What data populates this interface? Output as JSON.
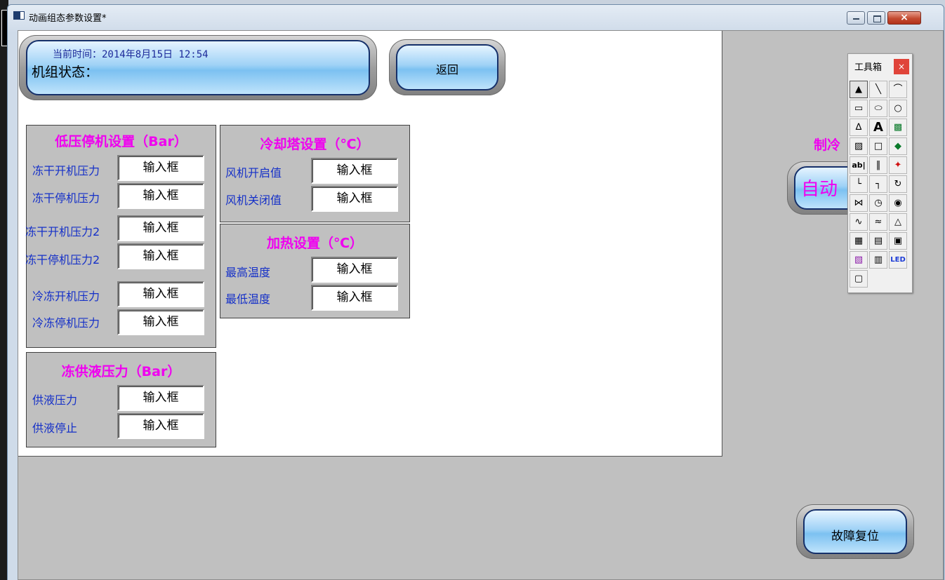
{
  "window": {
    "title": "动画组态参数设置*",
    "close_glyph": "×"
  },
  "header": {
    "time_label": "当前时间：",
    "time_value": "2014年8月15日 12:54",
    "status_label": "机组状态："
  },
  "back_button": "返回",
  "groups": {
    "low_pressure": {
      "title": "低压停机设置（Bar）",
      "rows": [
        {
          "label": "冻干开机压力",
          "value": "输入框"
        },
        {
          "label": "冻干停机压力",
          "value": "输入框"
        },
        {
          "label": "冻干开机压力2",
          "value": "输入框"
        },
        {
          "label": "冻干停机压力2",
          "value": "输入框"
        },
        {
          "label": "冷冻开机压力",
          "value": "输入框"
        },
        {
          "label": "冷冻停机压力",
          "value": "输入框"
        }
      ]
    },
    "supply": {
      "title": "冻供液压力（Bar）",
      "rows": [
        {
          "label": "供液压力",
          "value": "输入框"
        },
        {
          "label": "供液停止",
          "value": "输入框"
        }
      ]
    },
    "cooling_tower": {
      "title": "冷却塔设置（℃）",
      "rows": [
        {
          "label": "风机开启值",
          "value": "输入框"
        },
        {
          "label": "风机关闭值",
          "value": "输入框"
        }
      ]
    },
    "heating": {
      "title": "加热设置（℃）",
      "rows": [
        {
          "label": "最高温度",
          "value": "输入框"
        },
        {
          "label": "最低温度",
          "value": "输入框"
        }
      ]
    }
  },
  "right_panel": {
    "mode_title_partial": "制冷",
    "auto_button_partial": "自动",
    "fault_reset_button": "故障复位"
  },
  "toolbox": {
    "title": "工具箱",
    "close_label": "×",
    "tools": [
      "pointer",
      "line",
      "arc",
      "rectangle",
      "rounded-rect",
      "ellipse",
      "polygon",
      "text",
      "bitmap",
      "picture-button",
      "button-disabled",
      "web",
      "text-input",
      "slider",
      "alarm-switch",
      "angle-line",
      "step-line",
      "spin",
      "valve",
      "gauge",
      "indicator",
      "trend",
      "xy-trend",
      "alarm-bell",
      "grid",
      "table",
      "layers",
      "chart",
      "report",
      "led",
      "alarm-window"
    ],
    "text_tools": {
      "text": "A",
      "input": "ab|",
      "led": "LED"
    }
  },
  "colors": {
    "group_title": "#f000f0",
    "label_blue": "#1530c8",
    "button_blue": "#7cc1f1"
  }
}
